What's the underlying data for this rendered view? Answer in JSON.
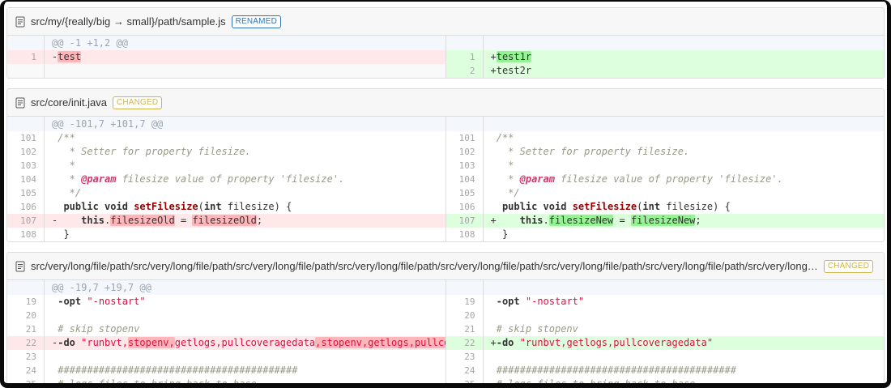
{
  "colors": {
    "renamed_tag": "#3572b0",
    "changed_tag": "#d0b44c",
    "del_line_bg": "#fee8e9",
    "del_word_bg": "#ffb6ba",
    "ins_line_bg": "#ddffdd",
    "ins_word_bg": "#97f295",
    "hunk_bg": "#f4f7fb",
    "string_color": "#d14",
    "comment_color": "#999988",
    "function_color": "#990000",
    "doctag_color": "#d6336c"
  },
  "files": [
    {
      "name": "src/my/{really/big → small}/path/sample.js",
      "tag": "RENAMED",
      "tag_color": "#3572b0",
      "left": {
        "rows": [
          {
            "t": "info",
            "n": "",
            "s": [
              [
                "",
                "@@ -1 +1,2 @@"
              ]
            ]
          },
          {
            "t": "del",
            "n": "1",
            "s": [
              [
                "",
                "-"
              ],
              [
                "hl-del",
                "test"
              ]
            ]
          },
          {
            "t": "empty",
            "n": "",
            "s": []
          }
        ]
      },
      "right": {
        "rows": [
          {
            "t": "info",
            "n": "",
            "s": []
          },
          {
            "t": "ins",
            "n": "1",
            "s": [
              [
                "",
                "+"
              ],
              [
                "hl-ins",
                "test1r"
              ]
            ]
          },
          {
            "t": "ins",
            "n": "2",
            "s": [
              [
                "",
                "+test2r"
              ]
            ]
          }
        ]
      }
    },
    {
      "name": "src/core/init.java",
      "tag": "CHANGED",
      "tag_color": "#d0b44c",
      "left": {
        "rows": [
          {
            "t": "info",
            "n": "",
            "s": [
              [
                "",
                "@@ -101,7 +101,7 @@"
              ]
            ]
          },
          {
            "t": "ctx",
            "n": "101",
            "s": [
              [
                "cm",
                " /**"
              ]
            ]
          },
          {
            "t": "ctx",
            "n": "102",
            "s": [
              [
                "cm",
                "   * Setter for property filesize."
              ]
            ]
          },
          {
            "t": "ctx",
            "n": "103",
            "s": [
              [
                "cm",
                "   *"
              ]
            ]
          },
          {
            "t": "ctx",
            "n": "104",
            "s": [
              [
                "cm",
                "   * "
              ],
              [
                "doctag",
                "@param"
              ],
              [
                "cm",
                " filesize value of property 'filesize'."
              ]
            ]
          },
          {
            "t": "ctx",
            "n": "105",
            "s": [
              [
                "cm",
                "   */"
              ]
            ]
          },
          {
            "t": "ctx",
            "n": "106",
            "s": [
              [
                "",
                "  "
              ],
              [
                "kw",
                "public"
              ],
              [
                "",
                " "
              ],
              [
                "kw",
                "void"
              ],
              [
                "",
                " "
              ],
              [
                "fn",
                "setFilesize"
              ],
              [
                "",
                "("
              ],
              [
                "kw",
                "int"
              ],
              [
                "",
                " filesize) {"
              ]
            ]
          },
          {
            "t": "del",
            "n": "107",
            "s": [
              [
                "",
                "-    "
              ],
              [
                "kw",
                "this"
              ],
              [
                "",
                "."
              ],
              [
                "hl-del",
                "filesizeOld"
              ],
              [
                "",
                " = "
              ],
              [
                "hl-del",
                "filesizeOld"
              ],
              [
                "",
                ";"
              ]
            ]
          },
          {
            "t": "ctx",
            "n": "108",
            "s": [
              [
                "",
                "  }"
              ]
            ]
          }
        ]
      },
      "right": {
        "rows": [
          {
            "t": "info",
            "n": "",
            "s": []
          },
          {
            "t": "ctx",
            "n": "101",
            "s": [
              [
                "cm",
                " /**"
              ]
            ]
          },
          {
            "t": "ctx",
            "n": "102",
            "s": [
              [
                "cm",
                "   * Setter for property filesize."
              ]
            ]
          },
          {
            "t": "ctx",
            "n": "103",
            "s": [
              [
                "cm",
                "   *"
              ]
            ]
          },
          {
            "t": "ctx",
            "n": "104",
            "s": [
              [
                "cm",
                "   * "
              ],
              [
                "doctag",
                "@param"
              ],
              [
                "cm",
                " filesize value of property 'filesize'."
              ]
            ]
          },
          {
            "t": "ctx",
            "n": "105",
            "s": [
              [
                "cm",
                "   */"
              ]
            ]
          },
          {
            "t": "ctx",
            "n": "106",
            "s": [
              [
                "",
                "  "
              ],
              [
                "kw",
                "public"
              ],
              [
                "",
                " "
              ],
              [
                "kw",
                "void"
              ],
              [
                "",
                " "
              ],
              [
                "fn",
                "setFilesize"
              ],
              [
                "",
                "("
              ],
              [
                "kw",
                "int"
              ],
              [
                "",
                " filesize) {"
              ]
            ]
          },
          {
            "t": "ins",
            "n": "107",
            "s": [
              [
                "",
                "+    "
              ],
              [
                "kw",
                "this"
              ],
              [
                "",
                "."
              ],
              [
                "hl-ins",
                "filesizeNew"
              ],
              [
                "",
                " = "
              ],
              [
                "hl-ins",
                "filesizeNew"
              ],
              [
                "",
                ";"
              ]
            ]
          },
          {
            "t": "ctx",
            "n": "108",
            "s": [
              [
                "",
                "  }"
              ]
            ]
          }
        ]
      }
    },
    {
      "name": "src/very/long/file/path/src/very/long/file/path/src/very/long/file/path/src/very/long/file/path/src/very/long/file/path/src/very/long/file/path/src/very/long/file/path/src/very/long…",
      "tag": "CHANGED",
      "tag_color": "#d0b44c",
      "left": {
        "rows": [
          {
            "t": "info",
            "n": "",
            "s": [
              [
                "",
                "@@ -19,7 +19,7 @@"
              ]
            ]
          },
          {
            "t": "ctx",
            "n": "19",
            "s": [
              [
                "",
                " "
              ],
              [
                "kw",
                "-opt"
              ],
              [
                "",
                " "
              ],
              [
                "str",
                "\"-nostart\""
              ]
            ]
          },
          {
            "t": "ctx",
            "n": "20",
            "s": []
          },
          {
            "t": "ctx",
            "n": "21",
            "s": [
              [
                "",
                " "
              ],
              [
                "cm",
                "# skip stopenv"
              ]
            ]
          },
          {
            "t": "del",
            "n": "22",
            "s": [
              [
                "",
                "-"
              ],
              [
                "kw",
                "-do"
              ],
              [
                "",
                " "
              ],
              [
                "str",
                "\"runbvt,"
              ],
              [
                "str hl-del",
                "stopenv,"
              ],
              [
                "str",
                "getlogs,pullcoveragedata"
              ],
              [
                "str hl-del",
                ",stopenv,getlogs,pullcoveragedata"
              ],
              [
                "str",
                "\""
              ]
            ]
          },
          {
            "t": "ctx",
            "n": "23",
            "s": []
          },
          {
            "t": "ctx",
            "n": "24",
            "s": [
              [
                "",
                " "
              ],
              [
                "cm2",
                "#########################################"
              ]
            ]
          },
          {
            "t": "ctx",
            "n": "25",
            "s": [
              [
                "",
                " "
              ],
              [
                "cm",
                "# logs files to bring back to base"
              ]
            ]
          }
        ]
      },
      "right": {
        "rows": [
          {
            "t": "info",
            "n": "",
            "s": []
          },
          {
            "t": "ctx",
            "n": "19",
            "s": [
              [
                "",
                " "
              ],
              [
                "kw",
                "-opt"
              ],
              [
                "",
                " "
              ],
              [
                "str",
                "\"-nostart\""
              ]
            ]
          },
          {
            "t": "ctx",
            "n": "20",
            "s": []
          },
          {
            "t": "ctx",
            "n": "21",
            "s": [
              [
                "",
                " "
              ],
              [
                "cm",
                "# skip stopenv"
              ]
            ]
          },
          {
            "t": "ins",
            "n": "22",
            "s": [
              [
                "",
                "+"
              ],
              [
                "kw",
                "-do"
              ],
              [
                "",
                " "
              ],
              [
                "str",
                "\"runbvt,getlogs,pullcoveragedata\""
              ]
            ]
          },
          {
            "t": "ctx",
            "n": "23",
            "s": []
          },
          {
            "t": "ctx",
            "n": "24",
            "s": [
              [
                "",
                " "
              ],
              [
                "cm2",
                "#########################################"
              ]
            ]
          },
          {
            "t": "ctx",
            "n": "25",
            "s": [
              [
                "",
                " "
              ],
              [
                "cm",
                "# logs files to bring back to base"
              ]
            ]
          }
        ]
      }
    }
  ]
}
